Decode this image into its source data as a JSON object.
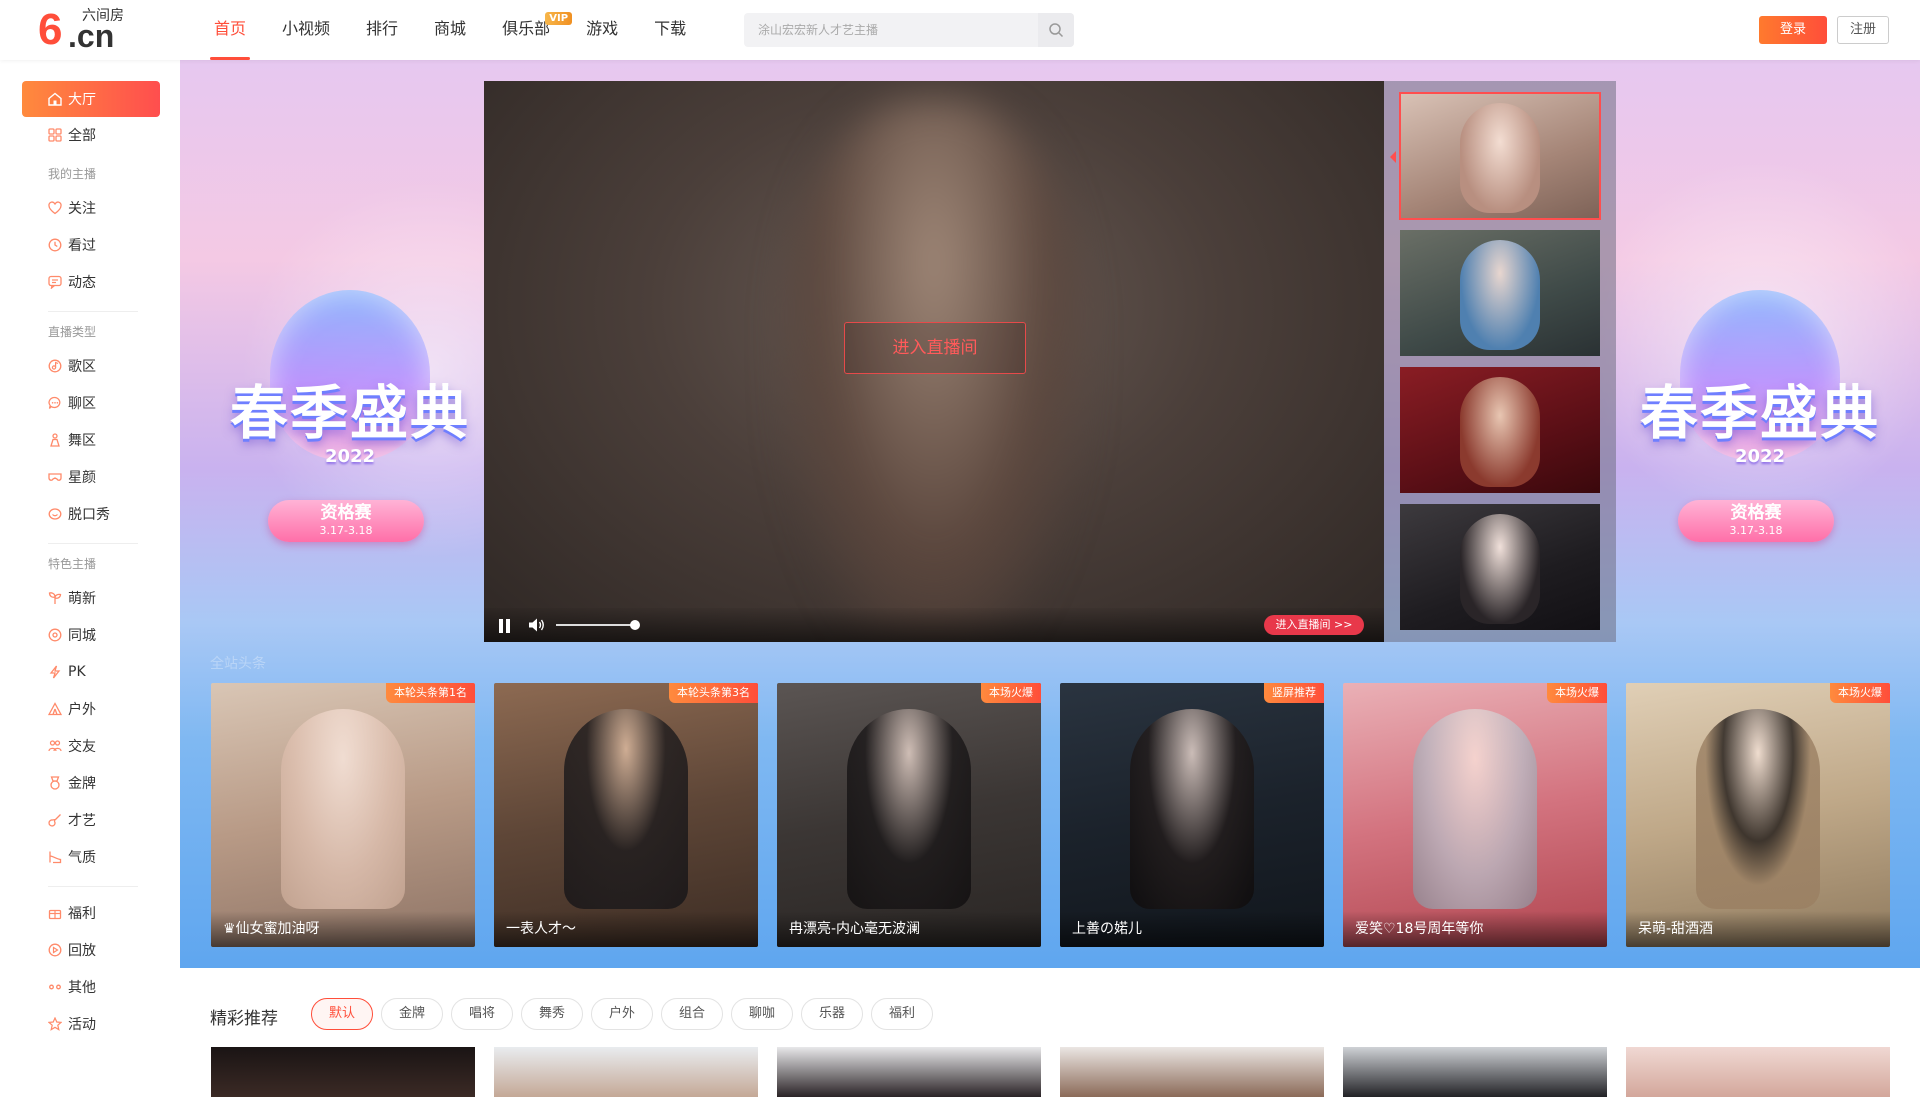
{
  "header": {
    "logo": {
      "six": "6",
      "cn": ".cn",
      "brand": "六间房"
    },
    "nav": [
      {
        "label": "首页"
      },
      {
        "label": "小视频"
      },
      {
        "label": "排行"
      },
      {
        "label": "商城"
      },
      {
        "label": "俱乐部",
        "badge": "VIP"
      },
      {
        "label": "游戏"
      },
      {
        "label": "下载"
      }
    ],
    "search_placeholder": "涂山宏宏新人才艺主播",
    "login": "登录",
    "register": "注册"
  },
  "sidebar": {
    "top": [
      {
        "label": "大厅",
        "icon": "home-icon"
      },
      {
        "label": "全部",
        "icon": "grid-icon"
      }
    ],
    "groups": [
      {
        "title": "我的主播",
        "items": [
          {
            "label": "关注",
            "icon": "heart-icon"
          },
          {
            "label": "看过",
            "icon": "clock-icon"
          },
          {
            "label": "动态",
            "icon": "message-icon"
          }
        ]
      },
      {
        "title": "直播类型",
        "items": [
          {
            "label": "歌区",
            "icon": "music-icon"
          },
          {
            "label": "聊区",
            "icon": "chat-icon"
          },
          {
            "label": "舞区",
            "icon": "dance-icon"
          },
          {
            "label": "星颜",
            "icon": "mask-icon"
          },
          {
            "label": "脱口秀",
            "icon": "talk-icon"
          }
        ]
      },
      {
        "title": "特色主播",
        "items": [
          {
            "label": "萌新",
            "icon": "sprout-icon"
          },
          {
            "label": "同城",
            "icon": "location-icon"
          },
          {
            "label": "PK",
            "icon": "lightning-icon"
          },
          {
            "label": "户外",
            "icon": "tent-icon"
          },
          {
            "label": "交友",
            "icon": "friends-icon"
          },
          {
            "label": "金牌",
            "icon": "medal-icon"
          },
          {
            "label": "才艺",
            "icon": "guitar-icon"
          },
          {
            "label": "气质",
            "icon": "heel-icon"
          }
        ]
      }
    ],
    "bottom": [
      {
        "label": "福利",
        "icon": "gift-icon"
      },
      {
        "label": "回放",
        "icon": "replay-icon"
      },
      {
        "label": "其他",
        "icon": "dots-icon"
      },
      {
        "label": "活动",
        "icon": "star-icon"
      }
    ]
  },
  "banner": {
    "event_title": "春季盛典",
    "event_year": "2022",
    "event_stage": "资格赛",
    "event_dates": "3.17-3.18"
  },
  "player": {
    "enter_room": "进入直播间",
    "enter_room_small": "进入直播间 >>",
    "volume": 1.0
  },
  "headline": {
    "title": "全站头条",
    "cards": [
      {
        "tag": "本轮头条第1名",
        "name": "♛仙女蜜加油呀"
      },
      {
        "tag": "本轮头条第3名",
        "name": "一表人才～"
      },
      {
        "tag": "本场火爆",
        "name": "冉漂亮-内心毫无波澜"
      },
      {
        "tag": "竖屏推荐",
        "name": "上善の婼儿"
      },
      {
        "tag": "本场火爆",
        "name": "爱笑♡18号周年等你"
      },
      {
        "tag": "本场火爆",
        "name": "呆萌-甜酒酒"
      }
    ]
  },
  "recommend": {
    "title": "精彩推荐",
    "chips": [
      "默认",
      "金牌",
      "唱将",
      "舞秀",
      "户外",
      "组合",
      "聊咖",
      "乐器",
      "福利"
    ]
  },
  "colors": {
    "accent": "#ff4e3a",
    "login_gradient_start": "#ff7a2e"
  }
}
